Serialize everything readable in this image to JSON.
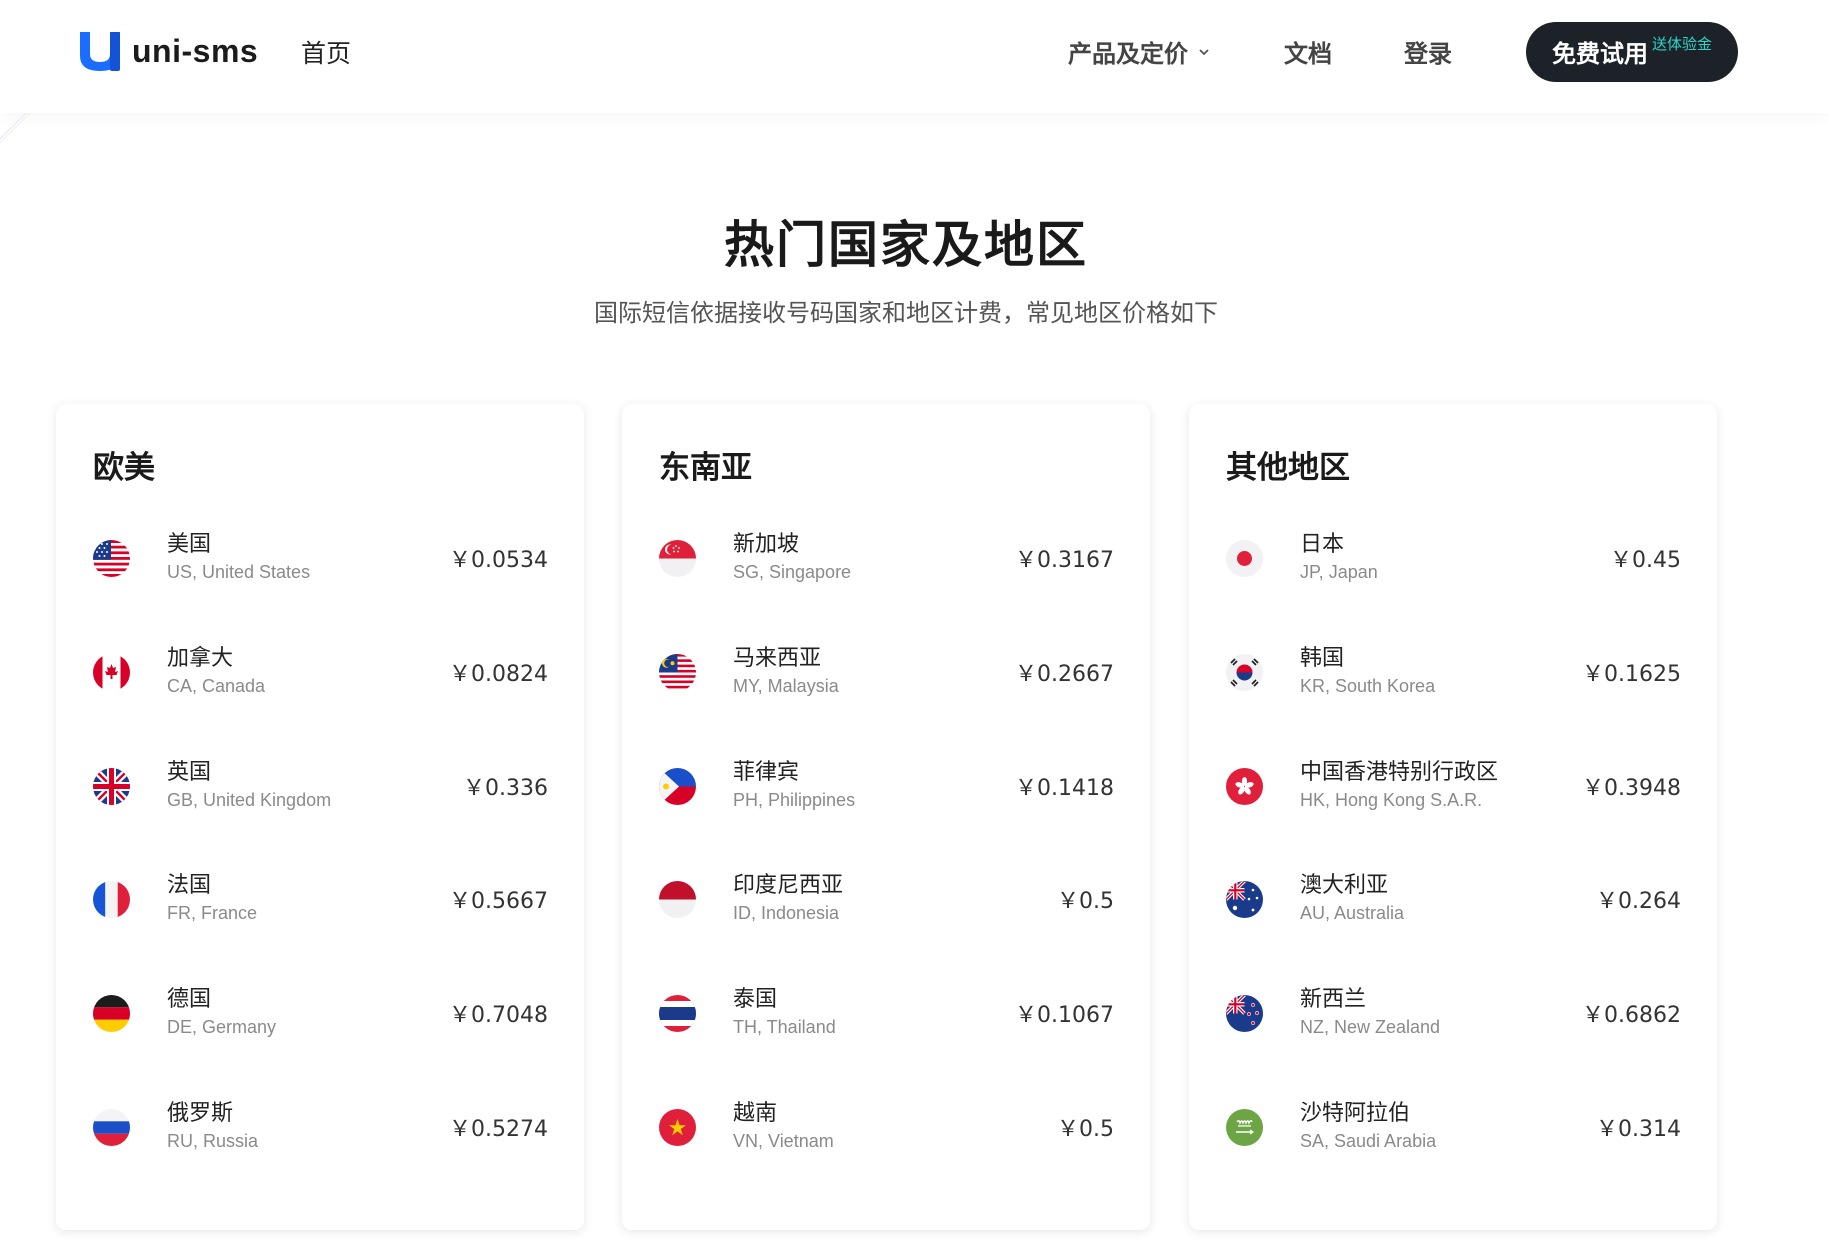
{
  "header": {
    "logo_text": "uni-sms",
    "home": "首页",
    "products": "产品及定价",
    "docs": "文档",
    "login": "登录",
    "trial": "免费试用",
    "trial_badge": "送体验金"
  },
  "hero": {
    "title": "热门国家及地区",
    "subtitle": "国际短信依据接收号码国家和地区计费，常见地区价格如下"
  },
  "regions": [
    {
      "title": "欧美",
      "items": [
        {
          "cn": "美国",
          "en": "US, United States",
          "price": "￥0.0534",
          "flag": "us-flag-icon"
        },
        {
          "cn": "加拿大",
          "en": "CA, Canada",
          "price": "￥0.0824",
          "flag": "ca-flag-icon"
        },
        {
          "cn": "英国",
          "en": "GB, United Kingdom",
          "price": "￥0.336",
          "flag": "gb-flag-icon"
        },
        {
          "cn": "法国",
          "en": "FR, France",
          "price": "￥0.5667",
          "flag": "fr-flag-icon"
        },
        {
          "cn": "德国",
          "en": "DE, Germany",
          "price": "￥0.7048",
          "flag": "de-flag-icon"
        },
        {
          "cn": "俄罗斯",
          "en": "RU, Russia",
          "price": "￥0.5274",
          "flag": "ru-flag-icon"
        }
      ]
    },
    {
      "title": "东南亚",
      "items": [
        {
          "cn": "新加坡",
          "en": "SG, Singapore",
          "price": "￥0.3167",
          "flag": "sg-flag-icon"
        },
        {
          "cn": "马来西亚",
          "en": "MY, Malaysia",
          "price": "￥0.2667",
          "flag": "my-flag-icon"
        },
        {
          "cn": "菲律宾",
          "en": "PH, Philippines",
          "price": "￥0.1418",
          "flag": "ph-flag-icon"
        },
        {
          "cn": "印度尼西亚",
          "en": "ID, Indonesia",
          "price": "￥0.5",
          "flag": "id-flag-icon"
        },
        {
          "cn": "泰国",
          "en": "TH, Thailand",
          "price": "￥0.1067",
          "flag": "th-flag-icon"
        },
        {
          "cn": "越南",
          "en": "VN, Vietnam",
          "price": "￥0.5",
          "flag": "vn-flag-icon"
        }
      ]
    },
    {
      "title": "其他地区",
      "items": [
        {
          "cn": "日本",
          "en": "JP, Japan",
          "price": "￥0.45",
          "flag": "jp-flag-icon"
        },
        {
          "cn": "韩国",
          "en": "KR, South Korea",
          "price": "￥0.1625",
          "flag": "kr-flag-icon"
        },
        {
          "cn": "中国香港特别行政区",
          "en": "HK, Hong Kong S.A.R.",
          "price": "￥0.3948",
          "flag": "hk-flag-icon"
        },
        {
          "cn": "澳大利亚",
          "en": "AU, Australia",
          "price": "￥0.264",
          "flag": "au-flag-icon"
        },
        {
          "cn": "新西兰",
          "en": "NZ, New Zealand",
          "price": "￥0.6862",
          "flag": "nz-flag-icon"
        },
        {
          "cn": "沙特阿拉伯",
          "en": "SA, Saudi Arabia",
          "price": "￥0.314",
          "flag": "sa-flag-icon"
        }
      ]
    }
  ],
  "colors": {
    "brand_blue": "#1a6dff",
    "trial_bg": "#1d2229",
    "trial_badge": "#2fd3c8"
  }
}
